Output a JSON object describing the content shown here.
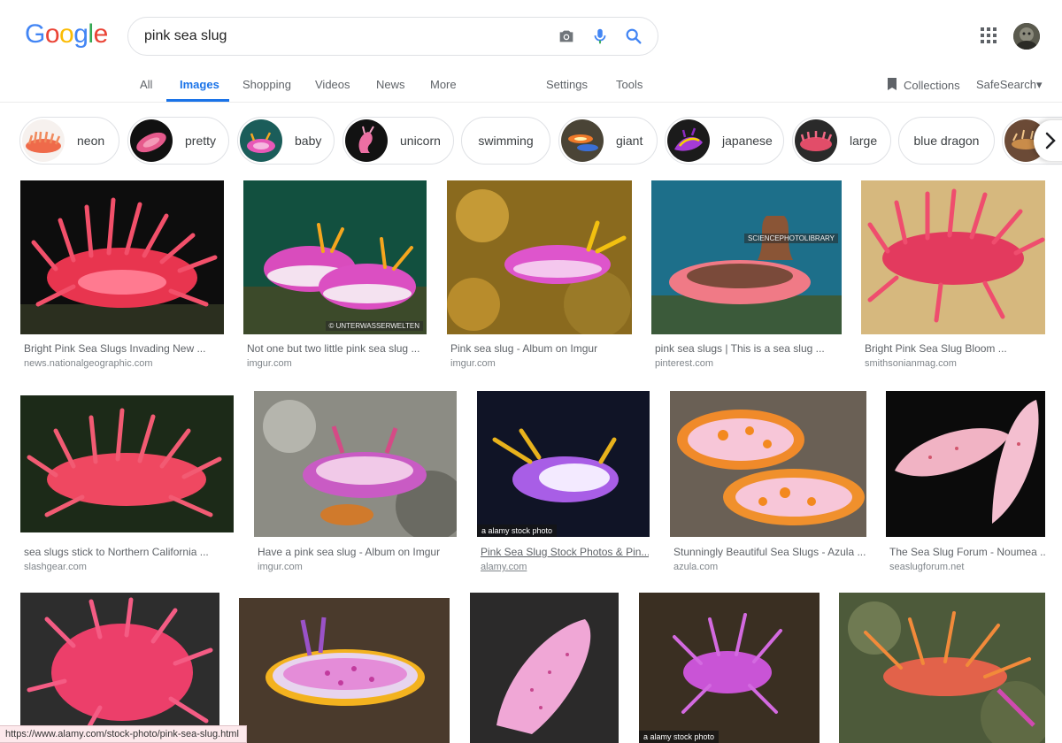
{
  "logo": {
    "letters": [
      "G",
      "o",
      "o",
      "g",
      "l",
      "e"
    ],
    "colors": [
      "#4285F4",
      "#EA4335",
      "#FBBC05",
      "#4285F4",
      "#34A853",
      "#EA4335"
    ]
  },
  "search": {
    "query": "pink sea slug",
    "icons": [
      "camera-icon",
      "microphone-icon",
      "search-icon"
    ]
  },
  "header": {
    "apps_icon": "apps-grid-icon",
    "avatar": "user-avatar"
  },
  "tabs": {
    "items": [
      "All",
      "Images",
      "Shopping",
      "Videos",
      "News",
      "More",
      "Settings",
      "Tools"
    ],
    "active": "Images",
    "collections_label": "Collections",
    "safesearch_label": "SafeSearch",
    "safesearch_caret": "▾"
  },
  "chips": [
    "neon",
    "pretty",
    "baby",
    "unicorn",
    "swimming",
    "giant",
    "japanese",
    "large",
    "blue dragon"
  ],
  "results": [
    {
      "title": "Bright Pink Sea Slugs Invading New ...",
      "site": "news.nationalgeographic.com"
    },
    {
      "title": "Not one but two little pink sea slug ...",
      "site": "imgur.com",
      "watermark": "© UNTERWASSERWELTEN"
    },
    {
      "title": "Pink sea slug - Album on Imgur",
      "site": "imgur.com"
    },
    {
      "title": "pink sea slugs | This is a sea slug ...",
      "site": "pinterest.com",
      "watermark": "SCIENCEPHOTOLIBRARY"
    },
    {
      "title": "Bright Pink Sea Slug Bloom ...",
      "site": "smithsonianmag.com"
    },
    {
      "title": "sea slugs stick to Northern California ...",
      "site": "slashgear.com"
    },
    {
      "title": "Have a pink sea slug - Album on Imgur",
      "site": "imgur.com"
    },
    {
      "title": "Pink Sea Slug Stock Photos & Pin...",
      "site": "alamy.com",
      "stock_tag": "a alamy stock photo"
    },
    {
      "title": "Stunningly Beautiful Sea Slugs - Azula ...",
      "site": "azula.com"
    },
    {
      "title": "The Sea Slug Forum - Noumea ...",
      "site": "seaslugforum.net"
    },
    {
      "title": "",
      "site": ""
    },
    {
      "title": "",
      "site": ""
    },
    {
      "title": "",
      "site": ""
    },
    {
      "title": "",
      "site": "",
      "stock_tag": "a alamy stock photo"
    },
    {
      "title": "",
      "site": ""
    }
  ],
  "status_bar": {
    "url": "https://www.alamy.com/stock-photo/pink-sea-slug.html"
  },
  "colors": {
    "accent": "#1a73e8",
    "chip_border": "#dfe1e5",
    "status_bg": "#fde9ec"
  }
}
